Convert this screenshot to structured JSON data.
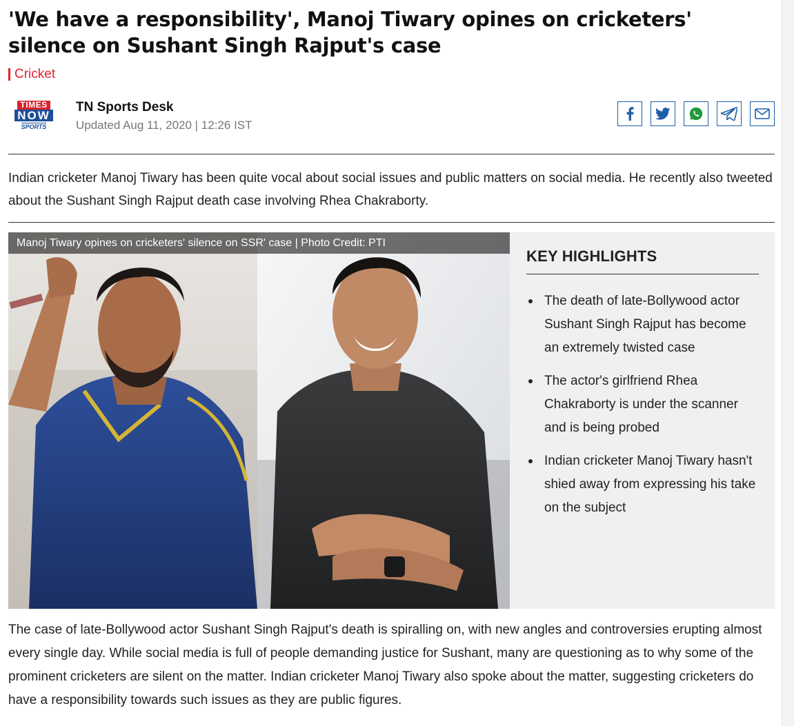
{
  "article": {
    "headline": "'We have a responsibility', Manoj Tiwary opines on cricketers' silence on Sushant Singh Rajput's case",
    "category": "Cricket",
    "logo": {
      "line1": "TIMES",
      "line2": "NOW",
      "line3": "SPORTS"
    },
    "author": "TN Sports Desk",
    "updated": "Updated Aug 11, 2020 | 12:26 IST",
    "summary": "Indian cricketer Manoj Tiwary has been quite vocal about social issues and public matters on social media. He recently also tweeted about the Sushant Singh Rajput death case involving Rhea Chakraborty.",
    "photo_caption": "Manoj Tiwary opines on cricketers' silence on SSR' case  |  Photo Credit: PTI",
    "body": "The case of late-Bollywood actor Sushant Singh Rajput's death is spiralling on, with new angles and controversies erupting almost every single day. While social media is full of people demanding justice for Sushant, many are questioning as to why some of the prominent cricketers are silent on the matter. Indian cricketer Manoj Tiwary also spoke about the matter, suggesting cricketers do have a responsibility towards such issues as they are public figures."
  },
  "share": [
    {
      "icon": "facebook-icon"
    },
    {
      "icon": "twitter-icon"
    },
    {
      "icon": "whatsapp-icon"
    },
    {
      "icon": "telegram-icon"
    },
    {
      "icon": "email-icon"
    }
  ],
  "highlights": {
    "title": "KEY HIGHLIGHTS",
    "items": [
      "The death of late-Bollywood actor Sushant Singh Rajput has become an extremely twisted case",
      "The actor's girlfriend Rhea Chakraborty is under the scanner and is being probed",
      "Indian cricketer Manoj Tiwary hasn't shied away from expressing his take on the subject"
    ]
  },
  "colors": {
    "category_red": "#e3212d",
    "share_blue": "#1e5fa8",
    "whatsapp_green": "#1f9a3a",
    "highlights_bg": "#f0f0f0"
  }
}
